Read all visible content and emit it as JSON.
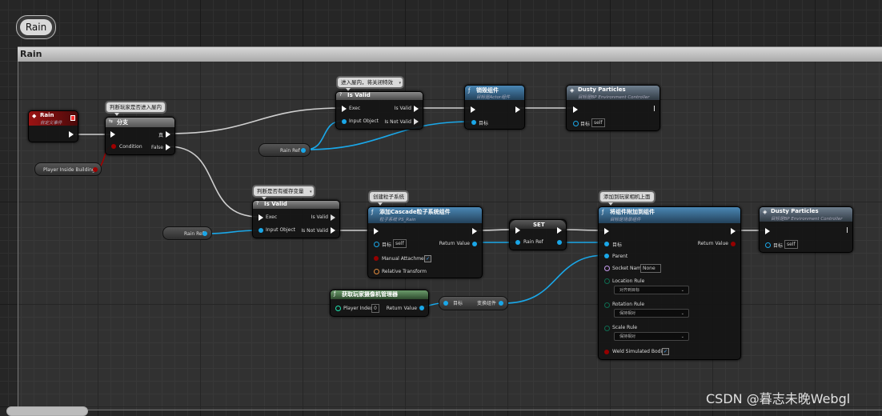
{
  "graph": {
    "title": "Rain",
    "comment_header": "Rain",
    "bottom_title": ""
  },
  "bubbles": {
    "branch": "判断玩家是否进入屋内",
    "isvalid1": "进入屋内，将关闭特效",
    "isvalid2": "判断是否有缓存变量",
    "spawn": "创建粒子系统",
    "attach": "添加到玩家相机上面"
  },
  "nodes": {
    "rain_event": {
      "title": "Rain",
      "subtitle": "自定义事件"
    },
    "branch": {
      "title": "分支",
      "true_label": "真",
      "false_label": "False",
      "condition_label": "Condition",
      "icon": "branch-icon"
    },
    "player_inside": {
      "label": "Player Inside Building"
    },
    "isvalid1": {
      "title": "Is Valid",
      "exec": "Exec",
      "is_valid": "Is Valid",
      "input_object": "Input Object",
      "is_not_valid": "Is Not Valid"
    },
    "rainref1": {
      "label": "Rain Ref"
    },
    "destroy": {
      "title": "销毁组件",
      "subtitle": "目标是Actor组件",
      "target": "目标"
    },
    "dusty1": {
      "title": "Dusty Particles",
      "subtitle": "目标是BP Environment Controller",
      "target": "目标",
      "self": "self"
    },
    "isvalid2": {
      "title": "Is Valid",
      "exec": "Exec",
      "is_valid": "Is Valid",
      "input_object": "Input Object",
      "is_not_valid": "Is Not Valid"
    },
    "rainref2": {
      "label": "Rain Ref"
    },
    "spawn": {
      "title": "添加Cascade粒子系统组件",
      "subtitle": "粒子系统 PS_Rain",
      "target": "目标",
      "self": "self",
      "return_value": "Return Value",
      "manual_attachment": "Manual Attachment",
      "relative_transform": "Relative Transform"
    },
    "set": {
      "title": "SET",
      "rain_ref": "Rain Ref"
    },
    "attach": {
      "title": "将组件附加到组件",
      "subtitle": "目标是场景组件",
      "target": "目标",
      "return_value": "Return Value",
      "parent": "Parent",
      "socket_name": "Socket Name",
      "socket_value": "None",
      "location_rule": "Location Rule",
      "location_value": "对齐到目标",
      "rotation_rule": "Rotation Rule",
      "rotation_value": "保持相对",
      "scale_rule": "Scale Rule",
      "scale_value": "保持相对",
      "weld": "Weld Simulated Bodies"
    },
    "dusty2": {
      "title": "Dusty Particles",
      "subtitle": "目标是BP Environment Controller",
      "target": "目标",
      "self": "self"
    },
    "camera_mgr": {
      "title": "获取玩家摄像机管理器",
      "player_index": "Player Index",
      "player_index_value": "0",
      "return_value": "Return Value"
    },
    "transform_comp": {
      "target": "目标",
      "label": "变换组件"
    }
  },
  "watermark": "CSDN @暮志未晚Webgl",
  "colors": {
    "exec": "#ffffff",
    "object": "#00a8f4",
    "bool": "#950000",
    "struct": "#e08a3c",
    "name": "#c89cf0",
    "enum": "#0e6b50",
    "event_header": "#8b0f0f",
    "function_header": "#2a5b80",
    "pure_header": "#3c6a3c",
    "macro_header": "#7a7a7a"
  }
}
